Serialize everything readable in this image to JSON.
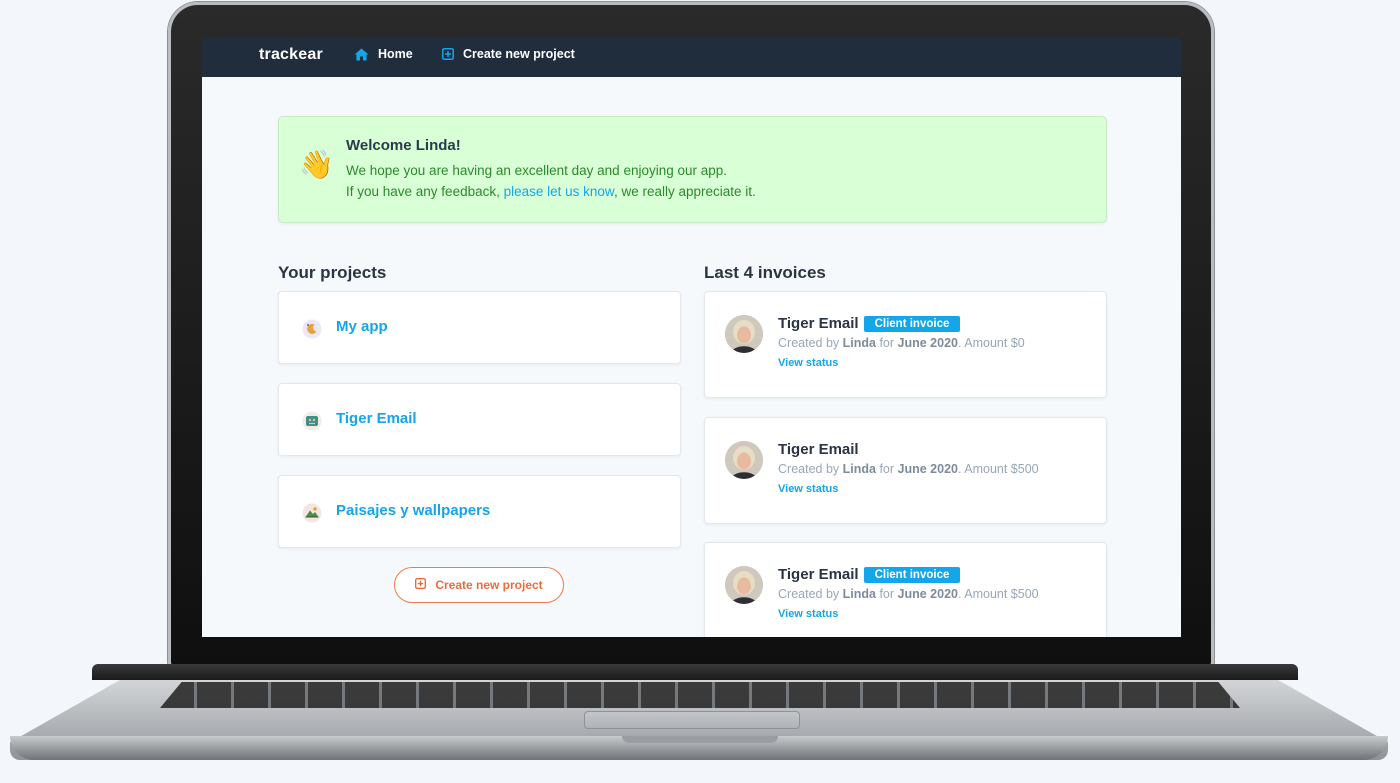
{
  "app": {
    "brand": "trackear"
  },
  "nav": {
    "items": [
      {
        "label": "Home",
        "icon": "home-icon"
      },
      {
        "label": "Create new project",
        "icon": "plus-square-icon"
      }
    ]
  },
  "welcome": {
    "emoji": "👋",
    "title": "Welcome Linda!",
    "line1": "We hope you are having an excellent day and enjoying our app.",
    "line2_before": "If you have any feedback, ",
    "line2_link": "please let us know",
    "line2_after": ", we really appreciate it."
  },
  "projects": {
    "heading": "Your projects",
    "items": [
      {
        "name": "My app",
        "icon": "moon-app-icon"
      },
      {
        "name": "Tiger Email",
        "icon": "tiger-app-icon"
      },
      {
        "name": "Paisajes y wallpapers",
        "icon": "landscape-app-icon"
      }
    ],
    "create_label": "Create new project"
  },
  "invoices": {
    "heading": "Last 4 invoices",
    "items": [
      {
        "title": "Tiger Email",
        "badge": "Client invoice",
        "created_prefix": "Created by ",
        "user": "Linda",
        "for_word": " for ",
        "period": "June 2020",
        "amount_text": ". Amount $0",
        "link": "View status"
      },
      {
        "title": "Tiger Email",
        "badge": "",
        "created_prefix": "Created by ",
        "user": "Linda",
        "for_word": " for ",
        "period": "June 2020",
        "amount_text": ". Amount $500",
        "link": "View status"
      },
      {
        "title": "Tiger Email",
        "badge": "Client invoice",
        "created_prefix": "Created by ",
        "user": "Linda",
        "for_word": " for ",
        "period": "June 2020",
        "amount_text": ". Amount $500",
        "link": "View status"
      }
    ]
  },
  "colors": {
    "navbar": "#1f2d3d",
    "accent": "#13a6e8",
    "welcome_bg": "#d9ffd6",
    "welcome_text": "#2a8a2a",
    "create_button": "#ea6b3b"
  }
}
